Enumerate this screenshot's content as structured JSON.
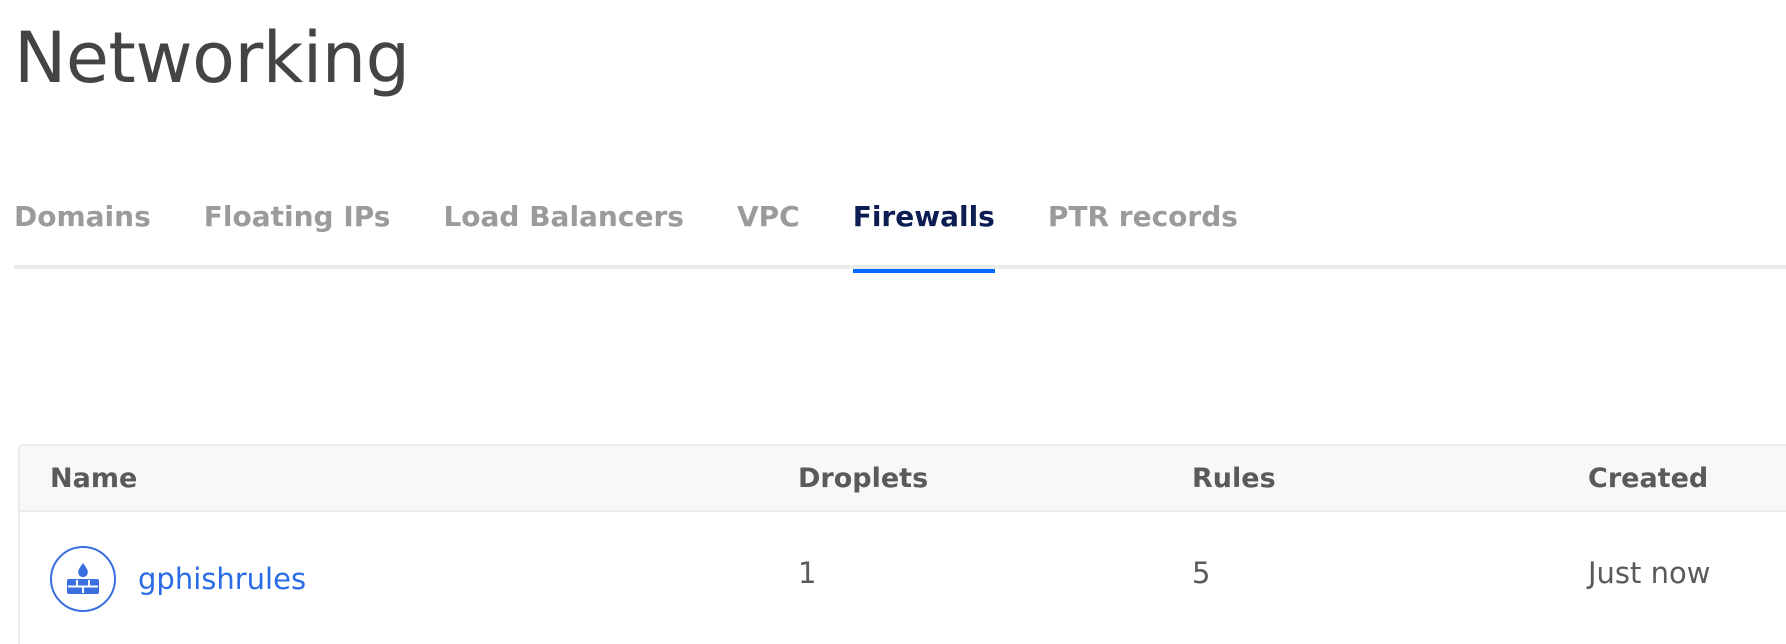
{
  "page": {
    "title": "Networking"
  },
  "tabs": [
    {
      "label": "Domains",
      "active": false
    },
    {
      "label": "Floating IPs",
      "active": false
    },
    {
      "label": "Load Balancers",
      "active": false
    },
    {
      "label": "VPC",
      "active": false
    },
    {
      "label": "Firewalls",
      "active": true
    },
    {
      "label": "PTR records",
      "active": false
    }
  ],
  "table": {
    "columns": [
      "Name",
      "Droplets",
      "Rules",
      "Created"
    ],
    "rows": [
      {
        "icon": "firewall-icon",
        "name": "gphishrules",
        "droplets": "1",
        "rules": "5",
        "created": "Just now"
      }
    ]
  },
  "colors": {
    "accent": "#0069ff",
    "active_tab_text": "#0b1d52",
    "link": "#2b6ce6",
    "icon_stroke": "#3b6fe0"
  }
}
